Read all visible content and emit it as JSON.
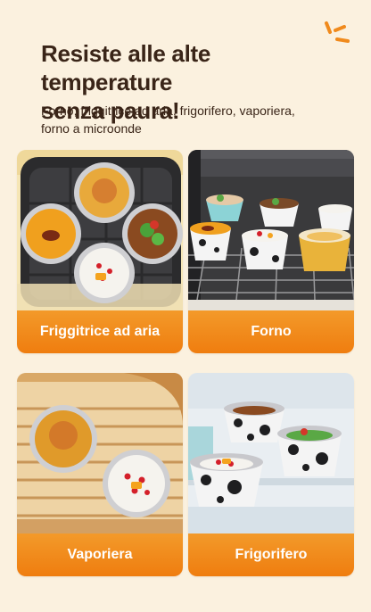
{
  "heading": {
    "line1": "Resiste alle alte temperature",
    "line2": "senza paura!"
  },
  "subtitle": {
    "line1": "Forno, friggitrice ad aria, frigorifero, vaporiera,",
    "line2": "forno a microonde"
  },
  "colors": {
    "background": "#fbf1df",
    "accent": "#ef7d0f",
    "title": "#3a2518"
  },
  "cards": [
    {
      "label": "Friggitrice ad aria"
    },
    {
      "label": "Forno"
    },
    {
      "label": "Vaporiera"
    },
    {
      "label": "Frigorifero"
    }
  ]
}
